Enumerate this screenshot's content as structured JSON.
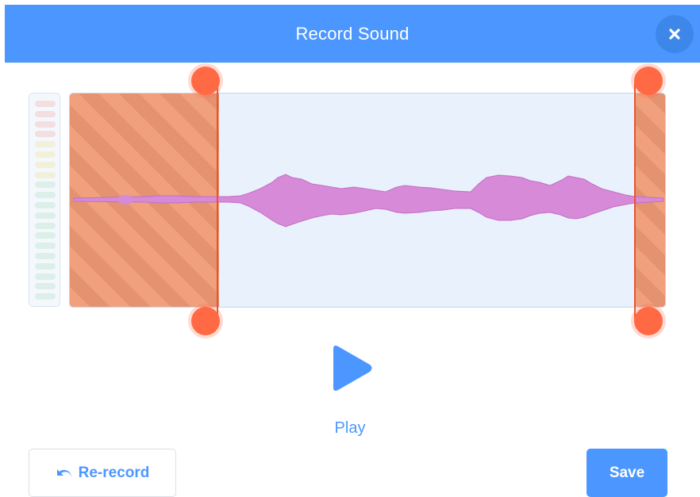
{
  "dialog": {
    "title": "Record Sound",
    "close_icon": "close-icon"
  },
  "editor": {
    "trim_start": 0.25,
    "trim_end": 0.95,
    "level_meter_segments": 20
  },
  "playback": {
    "play_label": "Play",
    "play_icon": "play-icon"
  },
  "footer": {
    "rerecord_label": "Re-record",
    "rerecord_icon": "undo-icon",
    "save_label": "Save"
  },
  "colors": {
    "accent": "#4c97ff",
    "trim_handle": "#ff6a45",
    "waveform": "#d68ad8"
  }
}
